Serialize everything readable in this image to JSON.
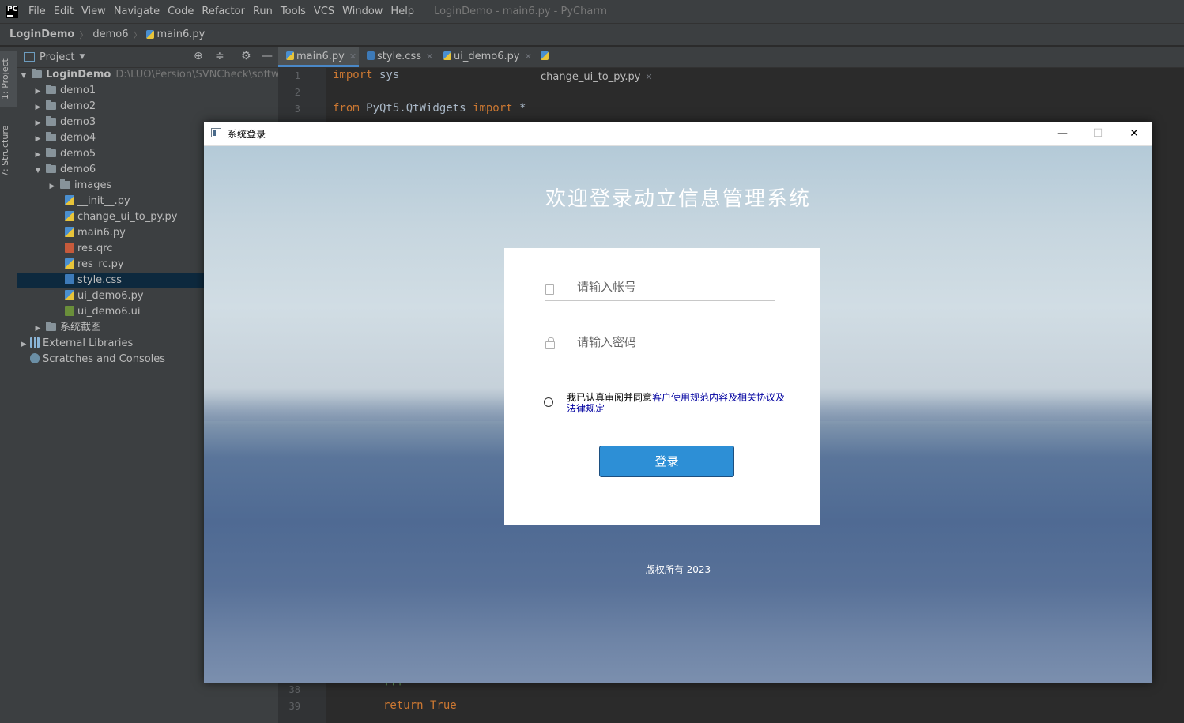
{
  "ide": {
    "logo": "PC",
    "menu": [
      "File",
      "Edit",
      "View",
      "Navigate",
      "Code",
      "Refactor",
      "Run",
      "Tools",
      "VCS",
      "Window",
      "Help"
    ],
    "window_title": "LoginDemo - main6.py - PyCharm",
    "breadcrumb": [
      "LoginDemo",
      "demo6",
      "main6.py"
    ],
    "side_tabs": {
      "project": "1: Project",
      "structure": "7: Structure"
    },
    "project_panel": {
      "title": "Project",
      "root": {
        "name": "LoginDemo",
        "path": "D:\\LUO\\Persion\\SVNCheck\\software\\"
      },
      "items": [
        {
          "label": "demo1"
        },
        {
          "label": "demo2"
        },
        {
          "label": "demo3"
        },
        {
          "label": "demo4"
        },
        {
          "label": "demo5"
        },
        {
          "label": "demo6"
        },
        {
          "label": "images"
        },
        {
          "label": "__init__.py"
        },
        {
          "label": "change_ui_to_py.py"
        },
        {
          "label": "main6.py"
        },
        {
          "label": "res.qrc"
        },
        {
          "label": "res_rc.py"
        },
        {
          "label": "style.css"
        },
        {
          "label": "ui_demo6.py"
        },
        {
          "label": "ui_demo6.ui"
        },
        {
          "label": "系统截图"
        },
        {
          "label": "External Libraries"
        },
        {
          "label": "Scratches and Consoles"
        }
      ]
    },
    "editor_tabs": [
      "main6.py",
      "style.css",
      "ui_demo6.py",
      "change_ui_to_py.py"
    ],
    "code_lines": [
      {
        "no": "1",
        "kw": "import",
        "rest": " sys"
      },
      {
        "no": "2",
        "kw": "",
        "rest": ""
      },
      {
        "no": "3",
        "kw": "from",
        "rest": " PyQt5.QtWidgets ",
        "kw2": "import",
        "rest2": " *"
      },
      {
        "no": "38",
        "kw": "",
        "rest": "'''"
      },
      {
        "no": "39",
        "kw": "return",
        "rest": " True"
      }
    ]
  },
  "dialog": {
    "title": "系统登录",
    "controls": {
      "minimize": "—",
      "maximize": "☐",
      "close": "✕"
    },
    "welcome": "欢迎登录动立信息管理系统",
    "account_placeholder": "请输入帐号",
    "password_placeholder": "请输入密码",
    "agree_prefix": "我已认真审阅并同意",
    "agree_link": "客户使用规范内容及相关协议及法律规定",
    "login_button": "登录",
    "copyright": "版权所有 2023"
  }
}
